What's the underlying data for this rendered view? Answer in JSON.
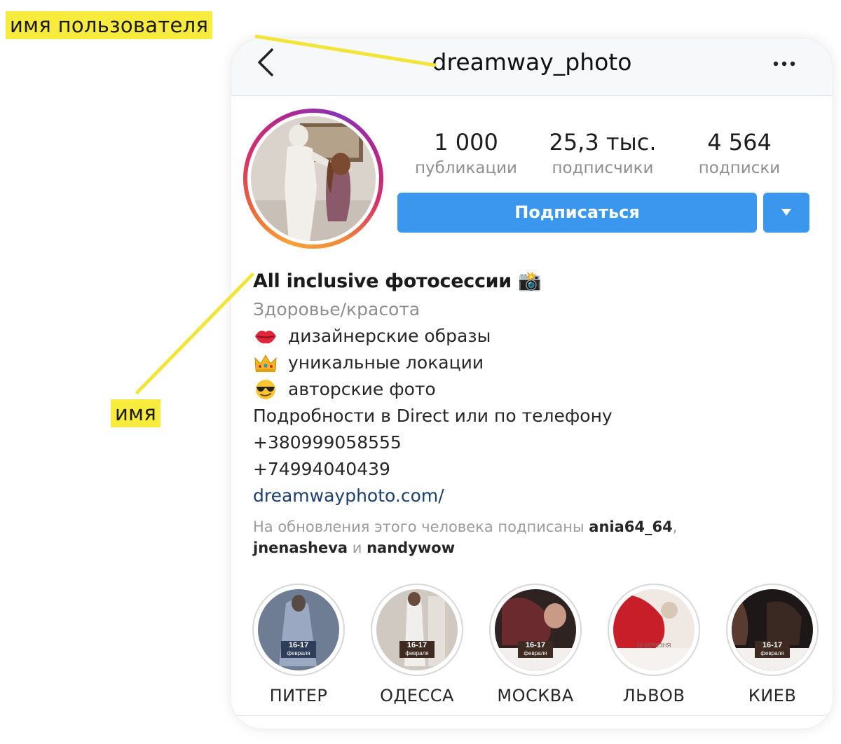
{
  "annotations": {
    "username_label": "имя пользователя",
    "name_label": "имя"
  },
  "header": {
    "username": "dreamway_photo"
  },
  "stats": [
    {
      "value": "1 000",
      "label": "публикации"
    },
    {
      "value": "25,3 тыс.",
      "label": "подписчики"
    },
    {
      "value": "4 564",
      "label": "подписки"
    }
  ],
  "actions": {
    "follow_label": "Подписаться"
  },
  "bio": {
    "name": "All inclusive фотосессии 📸",
    "category": "Здоровье/красота",
    "lines": [
      {
        "emoji": "kiss-icon",
        "text": "дизайнерские образы"
      },
      {
        "emoji": "crown-icon",
        "text": "уникальные локации"
      },
      {
        "emoji": "sunglasses-face-icon",
        "text": "авторские фото"
      }
    ],
    "details": "Подробности в Direct или по телефону",
    "phone_1": "+380999058555",
    "phone_2": "+74994040439",
    "website": "dreamwayphoto.com/",
    "followed_by": {
      "prefix": "На обновления этого человека подписаны",
      "user_1": "ania64_64",
      "comma": ",",
      "user_2": "jnenasheva",
      "and": "и",
      "user_3": "nandywow"
    }
  },
  "highlights": [
    {
      "label": "ПИТЕР",
      "date": "16-17",
      "month": "февраля"
    },
    {
      "label": "ОДЕССА",
      "date": "16-17",
      "month": "февраля"
    },
    {
      "label": "МОСКВА",
      "date": "16-17",
      "month": "февраля"
    },
    {
      "label": "ЛЬВОВ",
      "date": "10 БЕРЕЗНЯ",
      "month": ""
    },
    {
      "label": "КИЕВ",
      "date": "16-17",
      "month": "февраля"
    }
  ],
  "colors": {
    "accent": "#3a97ed",
    "annotation": "#f7ec3d"
  }
}
